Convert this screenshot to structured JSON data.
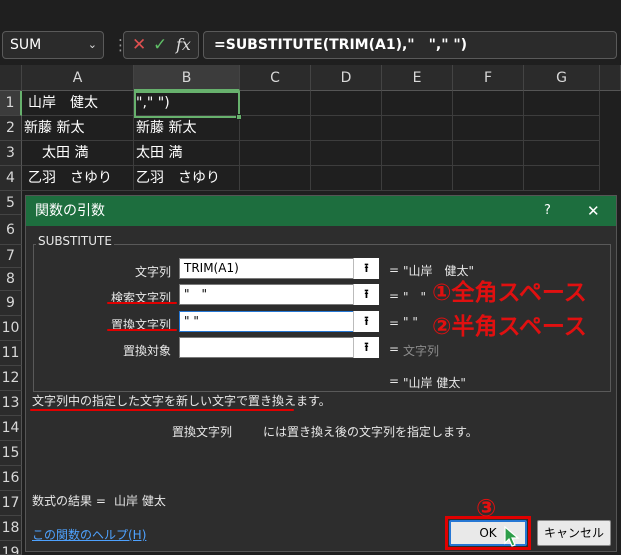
{
  "formula_bar": {
    "name_box": "SUM",
    "formula": "=SUBSTITUTE(TRIM(A1),\"　\",\" \")"
  },
  "columns": [
    "A",
    "B",
    "C",
    "D",
    "E",
    "F",
    "G"
  ],
  "rows": [
    "1",
    "2",
    "3",
    "4",
    "5",
    "6",
    "7",
    "8",
    "9",
    "10",
    "11",
    "12",
    "13",
    "14",
    "15",
    "16",
    "17",
    "18",
    "19"
  ],
  "cells": {
    "a1": "山岸　健太",
    "b1": "\",\" \")",
    "a2": "新藤 新太",
    "b2": "新藤 新太",
    "a3": "　太田 満",
    "b3": "太田 満",
    "a4": "乙羽　さゆり",
    "b4": "乙羽　さゆり"
  },
  "dialog": {
    "title": "関数の引数",
    "help_label": "?",
    "close_label": "✕",
    "function_name": "SUBSTITUTE",
    "args": [
      {
        "label": "文字列",
        "value": "TRIM(A1)",
        "result": "\"山岸　健太\""
      },
      {
        "label": "検索文字列",
        "value": "\"　\"",
        "result": "\"　\""
      },
      {
        "label": "置換文字列",
        "value": "\" \"",
        "result": "\" \""
      },
      {
        "label": "置換対象",
        "value": "",
        "result": "文字列"
      }
    ],
    "eq": "=",
    "overall_result": "\"山岸 健太\"",
    "description": "文字列中の指定した文字を新しい文字で置き換えます。",
    "arg_desc_name": "置換文字列",
    "arg_desc_text": "には置き換え後の文字列を指定します。",
    "result_label": "数式の結果 =",
    "result_value": "山岸 健太",
    "help_link": "この関数のヘルプ(H)",
    "ok_label": "OK",
    "cancel_label": "キャンセル"
  },
  "annotations": {
    "note1": "①全角スペース",
    "note2": "②半角スペース",
    "note3": "③"
  },
  "colors": {
    "accent_green": "#1d6e3e",
    "annotation_red": "#e00000"
  }
}
